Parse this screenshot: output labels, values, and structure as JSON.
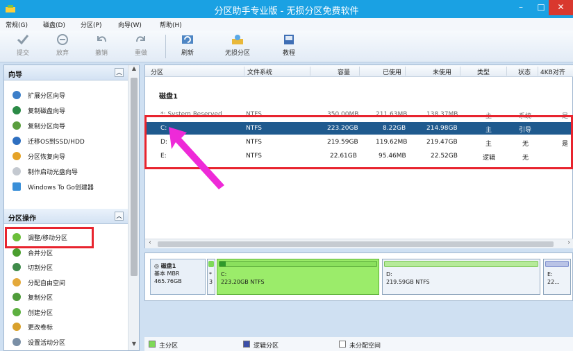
{
  "window": {
    "title": "分区助手专业版 - 无损分区免费软件"
  },
  "menu": [
    "常规(G)",
    "磁盘(D)",
    "分区(P)",
    "向导(W)",
    "帮助(H)"
  ],
  "toolbar": [
    {
      "label": "提交",
      "icon": "check-icon",
      "enabled": false
    },
    {
      "label": "放弃",
      "icon": "discard-icon",
      "enabled": false
    },
    {
      "label": "撤销",
      "icon": "undo-icon",
      "enabled": false
    },
    {
      "label": "重做",
      "icon": "redo-icon",
      "enabled": false
    },
    {
      "label": "刷新",
      "icon": "refresh-icon",
      "enabled": true
    },
    {
      "label": "无损分区",
      "icon": "partition-icon",
      "enabled": true
    },
    {
      "label": "教程",
      "icon": "tutorial-icon",
      "enabled": true
    }
  ],
  "wizard_panel": {
    "title": "向导",
    "items": [
      "扩展分区向导",
      "复制磁盘向导",
      "复制分区向导",
      "迁移OS到SSD/HDD",
      "分区恢复向导",
      "制作启动光盘向导",
      "Windows To Go创建器"
    ]
  },
  "ops_panel": {
    "title": "分区操作",
    "items": [
      "调整/移动分区",
      "合并分区",
      "切割分区",
      "分配自由空间",
      "复制分区",
      "创建分区",
      "更改卷标",
      "设置活动分区"
    ]
  },
  "table": {
    "columns": [
      "分区",
      "文件系统",
      "容量",
      "已使用",
      "未使用",
      "类型",
      "状态",
      "4KB对齐"
    ],
    "disk_label": "磁盘1",
    "rows": [
      {
        "name": "*: System Reserved",
        "fs": "NTFS",
        "capacity": "350.00MB",
        "used": "211.63MB",
        "free": "138.37MB",
        "type": "主",
        "status": "系统",
        "align": "是"
      },
      {
        "name": "C:",
        "fs": "NTFS",
        "capacity": "223.20GB",
        "used": "8.22GB",
        "free": "214.98GB",
        "type": "主",
        "status": "引导",
        "align": ""
      },
      {
        "name": "D:",
        "fs": "NTFS",
        "capacity": "219.59GB",
        "used": "119.62MB",
        "free": "219.47GB",
        "type": "主",
        "status": "无",
        "align": "是"
      },
      {
        "name": "E:",
        "fs": "NTFS",
        "capacity": "22.61GB",
        "used": "95.46MB",
        "free": "22.52GB",
        "type": "逻辑",
        "status": "无",
        "align": ""
      }
    ]
  },
  "disk_map": {
    "disk_name": "磁盘1",
    "disk_type": "基本 MBR",
    "disk_size": "465.76GB",
    "segments": [
      {
        "label": "*",
        "sub": "3"
      },
      {
        "label": "C:",
        "sub": "223.20GB NTFS"
      },
      {
        "label": "D:",
        "sub": "219.59GB NTFS"
      },
      {
        "label": "E:",
        "sub": "22..."
      }
    ]
  },
  "legend": [
    "主分区",
    "逻辑分区",
    "未分配空间"
  ],
  "colors": {
    "titlebar": "#1aa1e3",
    "selection": "#1f5a8e",
    "primary_partition": "#7ed957",
    "logical_partition": "#3b4fa8",
    "highlight": "#e8242e",
    "arrow": "#ee2ad8"
  }
}
